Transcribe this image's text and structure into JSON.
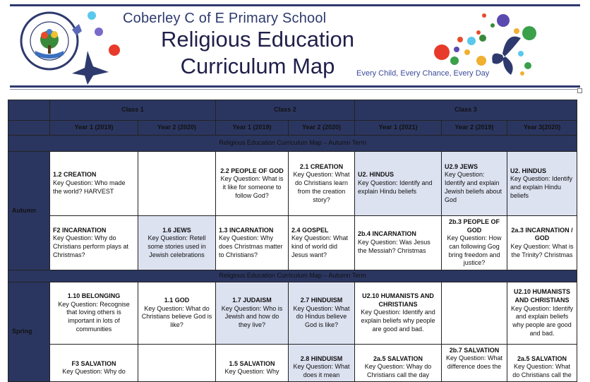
{
  "header": {
    "school_name": "Coberley C of E Primary School",
    "title_line1": "Religious Education",
    "title_line2": "Curriculum Map",
    "motto": "Every Child, Every Chance, Every Day",
    "logo_text_top": "COBERLEY CofE",
    "logo_text_bottom": "PRIMARY SCHOOL",
    "colors": {
      "navy": "#2b3660",
      "highlight": "#dde2f1"
    }
  },
  "table": {
    "classes": [
      "Class 1",
      "Class 2",
      "Class 3"
    ],
    "years": [
      "Year 1 (2019)",
      "Year 2 (2020)",
      "Year 1 (2019)",
      "Year 2 (2020)",
      "Year 1 (2021)",
      "Year 2 (2019)",
      "Year 3(2020)"
    ],
    "band1": "Religious Education Curriculum Map – Autumn Term",
    "band2": "Religious Education Curriculum Map – Autumn Term",
    "term_autumn": "Autumn",
    "term_spring": "Spring",
    "autumn_row1": [
      {
        "title": "1.2 CREATION",
        "text": "Key Question: Who made the world? HARVEST"
      },
      {
        "title": "",
        "text": ""
      },
      {
        "title": "2.2 PEOPLE OF GOD",
        "text": "Key Question: What is it like for someone to follow God?"
      },
      {
        "title": "2.1 CREATION",
        "text": "Key Question: What do Christians learn from the creation story?"
      },
      {
        "title": "U2. HINDUS",
        "text": "Key Question: Identify and explain Hindu beliefs"
      },
      {
        "title": "U2.9 JEWS",
        "text": "Key Question: Identify and explain Jewish beliefs about God"
      },
      {
        "title": "U2. HINDUS",
        "text": "Key Question: Identify and explain Hindu beliefs"
      }
    ],
    "autumn_row2": [
      {
        "title": "F2 INCARNATION",
        "text": "Key Question: Why do Christians perform plays at Christmas?"
      },
      {
        "title": "1.6 JEWS",
        "text": "Key Question: Retell some stories used in Jewish celebrations"
      },
      {
        "title": "1.3 INCARNATION",
        "text": "Key Question: Why does Christmas matter to Christians?"
      },
      {
        "title": "2.4 GOSPEL",
        "text": "Key Question: What kind of world did Jesus want?"
      },
      {
        "title": "2b.4 INCARNATION",
        "text": "Key Question: Was Jesus the Messiah? Christmas"
      },
      {
        "title": "2b.3 PEOPLE OF GOD",
        "text": "Key Question: How can following Gog bring freedom and justice?"
      },
      {
        "title": "2a.3 INCARNATION / GOD",
        "text": "Key Question: What is the Trinity? Christmas"
      }
    ],
    "spring_row1": [
      {
        "title": "1.10 BELONGING",
        "text": "Key Question: Recognise that loving others is important in lots of communities"
      },
      {
        "title": "1.1 GOD",
        "text": "Key Question: What do Christians believe God is like?"
      },
      {
        "title": "1.7 JUDAISM",
        "text": "Key Question: Who is Jewish and how do they live?"
      },
      {
        "title": "2.7 HINDUISM",
        "text": "Key Question: What do Hindus believe God is like?"
      },
      {
        "title": "U2.10 HUMANISTS AND CHRISTIANS",
        "text": "Key Question: Identify and explain beliefs why people are good and bad."
      },
      {
        "title": "",
        "text": ""
      },
      {
        "title": "U2.10 HUMANISTS AND CHRISTIANS",
        "text": "Key Question: Identify and explain beliefs  why people are good and bad."
      }
    ],
    "spring_row2": [
      {
        "title": "F3 SALVATION",
        "text": "Key Question: Why do"
      },
      {
        "title": "",
        "text": ""
      },
      {
        "title": "1.5 SALVATION",
        "text": "Key Question: Why"
      },
      {
        "title": "2.8 HINDUISM",
        "text": "Key Question: What does it mean"
      },
      {
        "title": "2a.5 SALVATION",
        "text": "Key Question: Whay do Christians call the day"
      },
      {
        "title": "2b.7 SALVATION",
        "text": "Key Question: What difference does the"
      },
      {
        "title": "2a.5 SALVATION",
        "text": "Key Question: What do Christians call the"
      }
    ]
  }
}
